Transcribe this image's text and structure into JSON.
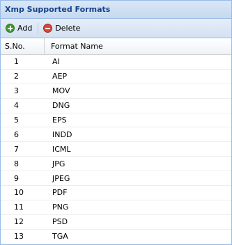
{
  "panel": {
    "title": "Xmp Supported Formats"
  },
  "toolbar": {
    "add_label": "Add",
    "delete_label": "Delete",
    "add_icon": "add-icon",
    "delete_icon": "delete-icon"
  },
  "grid": {
    "columns": [
      "S.No.",
      "Format Name"
    ],
    "rows": [
      {
        "sno": "1",
        "name": "AI"
      },
      {
        "sno": "2",
        "name": "AEP"
      },
      {
        "sno": "3",
        "name": "MOV"
      },
      {
        "sno": "4",
        "name": "DNG"
      },
      {
        "sno": "5",
        "name": "EPS"
      },
      {
        "sno": "6",
        "name": "INDD"
      },
      {
        "sno": "7",
        "name": "ICML"
      },
      {
        "sno": "8",
        "name": "JPG"
      },
      {
        "sno": "9",
        "name": "JPEG"
      },
      {
        "sno": "10",
        "name": "PDF"
      },
      {
        "sno": "11",
        "name": "PNG"
      },
      {
        "sno": "12",
        "name": "PSD"
      },
      {
        "sno": "13",
        "name": "TGA"
      }
    ]
  },
  "colors": {
    "title_text": "#15428b",
    "border": "#99bbe8",
    "add_icon": "#3f9b2b",
    "delete_icon": "#d8463a"
  }
}
